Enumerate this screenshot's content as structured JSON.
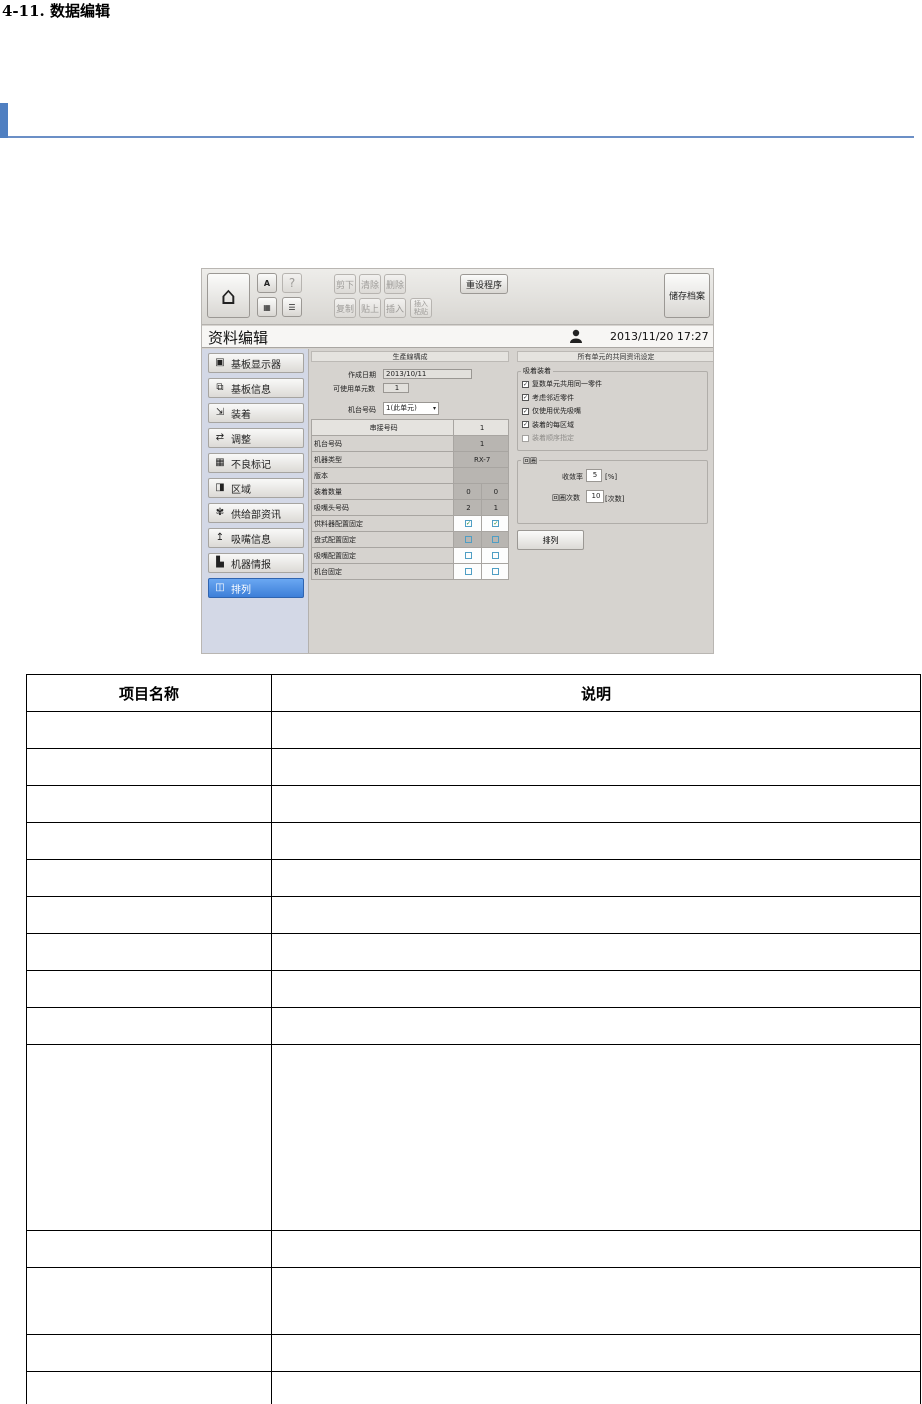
{
  "doc": {
    "heading": "4-11. 数据编辑"
  },
  "app": {
    "toolbar": {
      "help": "?",
      "cut": "剪下",
      "clear": "清除",
      "delete": "删除",
      "copy": "复制",
      "paste": "贴上",
      "insert": "插入",
      "insert_paste": "插入粘贴",
      "reset_program": "重设程序",
      "save_file": "储存档案"
    },
    "title": "资料编辑",
    "datetime": "2013/11/20 17:27",
    "sidebar": [
      {
        "label": "基板显示器",
        "icon": "board-display-icon",
        "glyph": "▣"
      },
      {
        "label": "基板信息",
        "icon": "board-info-icon",
        "glyph": "⧉"
      },
      {
        "label": "装着",
        "icon": "mount-icon",
        "glyph": "⇲"
      },
      {
        "label": "调整",
        "icon": "adjust-icon",
        "glyph": "⇄"
      },
      {
        "label": "不良标记",
        "icon": "bad-mark-icon",
        "glyph": "▦"
      },
      {
        "label": "区域",
        "icon": "area-icon",
        "glyph": "◨"
      },
      {
        "label": "供给部资讯",
        "icon": "feeder-info-icon",
        "glyph": "✾"
      },
      {
        "label": "吸嘴信息",
        "icon": "nozzle-info-icon",
        "glyph": "↥"
      },
      {
        "label": "机器情报",
        "icon": "machine-info-icon",
        "glyph": "▙"
      },
      {
        "label": "排列",
        "icon": "arrange-icon",
        "glyph": "◫"
      }
    ],
    "production": {
      "header": "生產線構成",
      "created_date_label": "作成日期",
      "created_date": "2013/10/11",
      "usable_units_label": "可使用单元数",
      "usable_units": "1",
      "machine_no_label": "机台号码",
      "machine_no_value": "1(此单元)"
    },
    "grid": {
      "rows": [
        {
          "label": "串接号码",
          "v1": "1"
        },
        {
          "label": "机台号码",
          "v1": "1"
        },
        {
          "label": "机器类型",
          "v1": "RX-7"
        },
        {
          "label": "版本",
          "v1": ""
        }
      ],
      "rows2": [
        {
          "label": "装着数量",
          "a": "0",
          "b": "0"
        },
        {
          "label": "吸嘴头号码",
          "a": "2",
          "b": "1"
        }
      ],
      "check_rows": [
        {
          "label": "供料器配置固定",
          "a": true,
          "b": true
        },
        {
          "label": "盘式配置固定",
          "a": false,
          "b": false
        },
        {
          "label": "吸嘴配置固定",
          "a": false,
          "b": false
        },
        {
          "label": "机台固定",
          "a": false,
          "b": false
        }
      ]
    },
    "shared": {
      "header": "所有单元的共同资讯设定",
      "pickup_group": "吸着装着",
      "options": [
        {
          "label": "复数单元共用同一零件",
          "checked": true,
          "disabled": false
        },
        {
          "label": "考虑邻近零件",
          "checked": true,
          "disabled": false
        },
        {
          "label": "仅使用优先吸嘴",
          "checked": true,
          "disabled": false
        },
        {
          "label": "装着的每区域",
          "checked": true,
          "disabled": false
        },
        {
          "label": "装着顺序指定",
          "checked": false,
          "disabled": true
        }
      ],
      "loop_group": "回圈",
      "convergence_label": "收敛率",
      "convergence_value": "5",
      "convergence_unit": "[%]",
      "loop_count_label": "回圈次数",
      "loop_count_value": "10",
      "loop_count_unit": "[次数]",
      "arrange_button": "排列"
    }
  },
  "table": {
    "headers": [
      "项目名称",
      "说明"
    ],
    "row_heights": [
      37,
      37,
      37,
      37,
      37,
      37,
      37,
      37,
      37,
      186,
      37,
      67,
      37,
      37
    ]
  }
}
